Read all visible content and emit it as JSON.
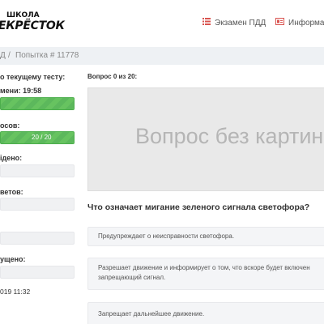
{
  "header": {
    "logo_top": "ШКОЛА",
    "logo_main": "ЕКРЁСТОК",
    "nav": [
      {
        "label": "Экзамен ПДД",
        "icon": "list-icon"
      },
      {
        "label": "Информац",
        "icon": "id-card-icon"
      }
    ]
  },
  "breadcrumb": {
    "item1": "Д",
    "separator": "/",
    "item2": "Попытка # 11778"
  },
  "sidebar": {
    "title": "о текущему тесту:",
    "time_label": "мени: 19:58",
    "time_progress": 1.0,
    "questions_label": "осов:",
    "questions_value": "20 / 20",
    "questions_progress": 1.0,
    "passed_label": "ідено:",
    "answers_label": "ветов:",
    "skipped_label": "ущено:",
    "date_text": "019 11:32"
  },
  "main": {
    "counter": "Вопрос 0 из 20:",
    "image_placeholder": "Вопрос без картинки",
    "question": "Что означает мигание зеленого сигнала светофора?",
    "answers": [
      "Предупреждает о неисправности светофора.",
      "Разрешает движение и информирует о том, что вскоре будет включен запрещающий сигнал.",
      "Запрещает дальнейшее движение."
    ]
  },
  "colors": {
    "accent_red": "#d9534f",
    "progress_green": "#5cb85c",
    "header_bg": "#ffffff",
    "crumb_bg": "#eef1f4"
  }
}
